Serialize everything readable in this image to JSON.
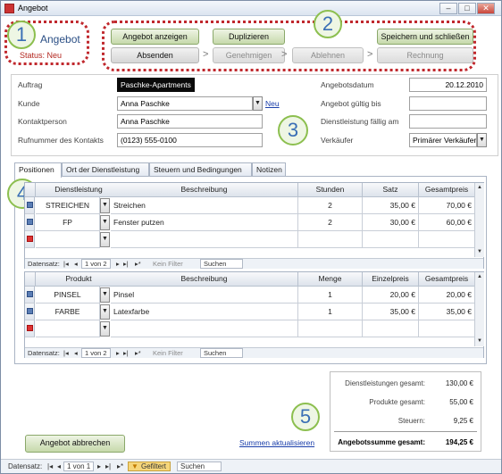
{
  "window": {
    "title": "Angebot",
    "minimize": "–",
    "maximize": "□",
    "close": "✕"
  },
  "header": {
    "form_title": "Angebot",
    "status_text": "Status: Neu",
    "callouts": [
      "1",
      "2",
      "3",
      "4",
      "5"
    ],
    "buttons_row1": [
      "Angebot anzeigen",
      "Duplizieren",
      "Speichern und schließen"
    ],
    "buttons_row2": [
      "Absenden",
      "Genehmigen",
      "Ablehnen",
      "Rechnung"
    ],
    "arrow": ">"
  },
  "form": {
    "auftrag_label": "Auftrag",
    "auftrag_value": "Paschke-Apartments",
    "kunde_label": "Kunde",
    "kunde_value": "Anna Paschke",
    "kunde_new_link": "Neu",
    "kontakt_label": "Kontaktperson",
    "kontakt_value": "Anna Paschke",
    "telefon_label": "Rufnummer des Kontakts",
    "telefon_value": "(0123) 555-0100",
    "datum_label": "Angebotsdatum",
    "datum_value": "20.12.2010",
    "gueltig_label": "Angebot gültig bis",
    "gueltig_value": "",
    "faellig_label": "Dienstleistung fällig am",
    "faellig_value": "",
    "verkaeufer_label": "Verkäufer",
    "verkaeufer_value": "Primärer Verkäufer"
  },
  "tabs": [
    "Positionen",
    "Ort der Dienstleistung",
    "Steuern und Bedingungen",
    "Notizen"
  ],
  "services": {
    "headers": [
      "Dienstleistung",
      "Beschreibung",
      "Stunden",
      "Satz",
      "Gesamtpreis"
    ],
    "rows": [
      [
        "STREICHEN",
        "Streichen",
        "2",
        "35,00 €",
        "70,00 €"
      ],
      [
        "FP",
        "Fenster putzen",
        "2",
        "30,00 €",
        "60,00 €"
      ]
    ],
    "nav": {
      "label": "Datensatz:",
      "record": "1 von 2",
      "filter": "Kein Filter",
      "search": "Suchen"
    }
  },
  "products": {
    "headers": [
      "Produkt",
      "Beschreibung",
      "Menge",
      "Einzelpreis",
      "Gesamtpreis"
    ],
    "rows": [
      [
        "PINSEL",
        "Pinsel",
        "1",
        "20,00 €",
        "20,00 €"
      ],
      [
        "FARBE",
        "Latexfarbe",
        "1",
        "35,00 €",
        "35,00 €"
      ]
    ],
    "nav": {
      "label": "Datensatz:",
      "record": "1 von 2",
      "filter": "Kein Filter",
      "search": "Suchen"
    }
  },
  "totals": {
    "services_label": "Dienstleistungen gesamt:",
    "services_value": "130,00 €",
    "products_label": "Produkte gesamt:",
    "products_value": "55,00 €",
    "tax_label": "Steuern:",
    "tax_value": "9,25 €",
    "total_label": "Angebotssumme gesamt:",
    "total_value": "194,25 €"
  },
  "update_link": "Summen aktualisieren",
  "cancel_button": "Angebot abbrechen",
  "statusbar": {
    "label": "Datensatz:",
    "record": "1 von 1",
    "filter": "Gefiltert",
    "search": "Suchen"
  },
  "nav_icons": {
    "first": "|◂",
    "prev": "◂",
    "next": "▸",
    "last": "▸|",
    "new": "▸*"
  },
  "colors": {
    "accent_green": "#8cbf4f",
    "callout_red": "#c0282d",
    "link_blue": "#1a3eaa"
  }
}
